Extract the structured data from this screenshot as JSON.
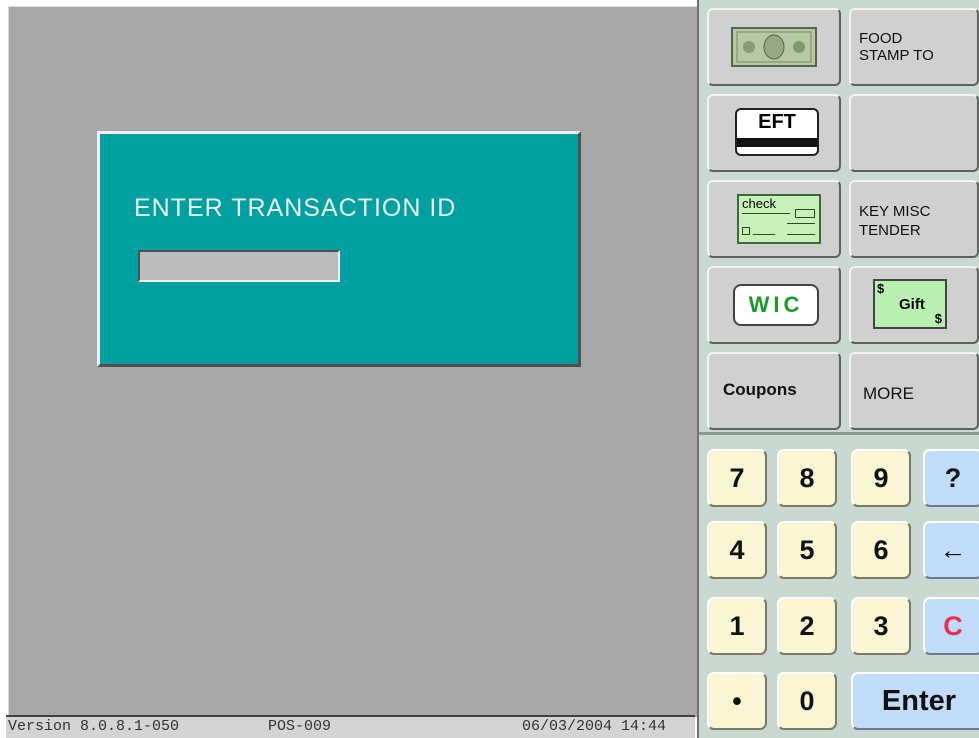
{
  "dialog": {
    "prompt": "ENTER TRANSACTION ID",
    "input_value": "",
    "input_placeholder": ""
  },
  "status": {
    "version": "Version  8.0.8.1-050",
    "terminal": "POS-009",
    "datetime": "06/03/2004 14:44"
  },
  "tender": {
    "cash_label": "",
    "food_stamp_label": "FOOD\nSTAMP TO",
    "eft_label": "EFT",
    "blank_label": "",
    "check_label": "check",
    "key_misc_label": "KEY MISC\nTENDER",
    "wic_label": "WIC",
    "gift_label": "Gift",
    "gift_symbol": "$",
    "coupons_label": "Coupons",
    "more_label": "MORE"
  },
  "keypad": {
    "k7": "7",
    "k8": "8",
    "k9": "9",
    "help": "?",
    "k4": "4",
    "k5": "5",
    "k6": "6",
    "back": "←",
    "k1": "1",
    "k2": "2",
    "k3": "3",
    "clear": "C",
    "dot": "•",
    "k0": "0",
    "enter": "Enter"
  },
  "colors": {
    "dialog": "#00a0a0",
    "screen": "#a8a8a8",
    "key": "#faf5d2",
    "key_blue": "#c0dcf8",
    "clear": "#e8304a",
    "wic": "#1a9a2a"
  }
}
